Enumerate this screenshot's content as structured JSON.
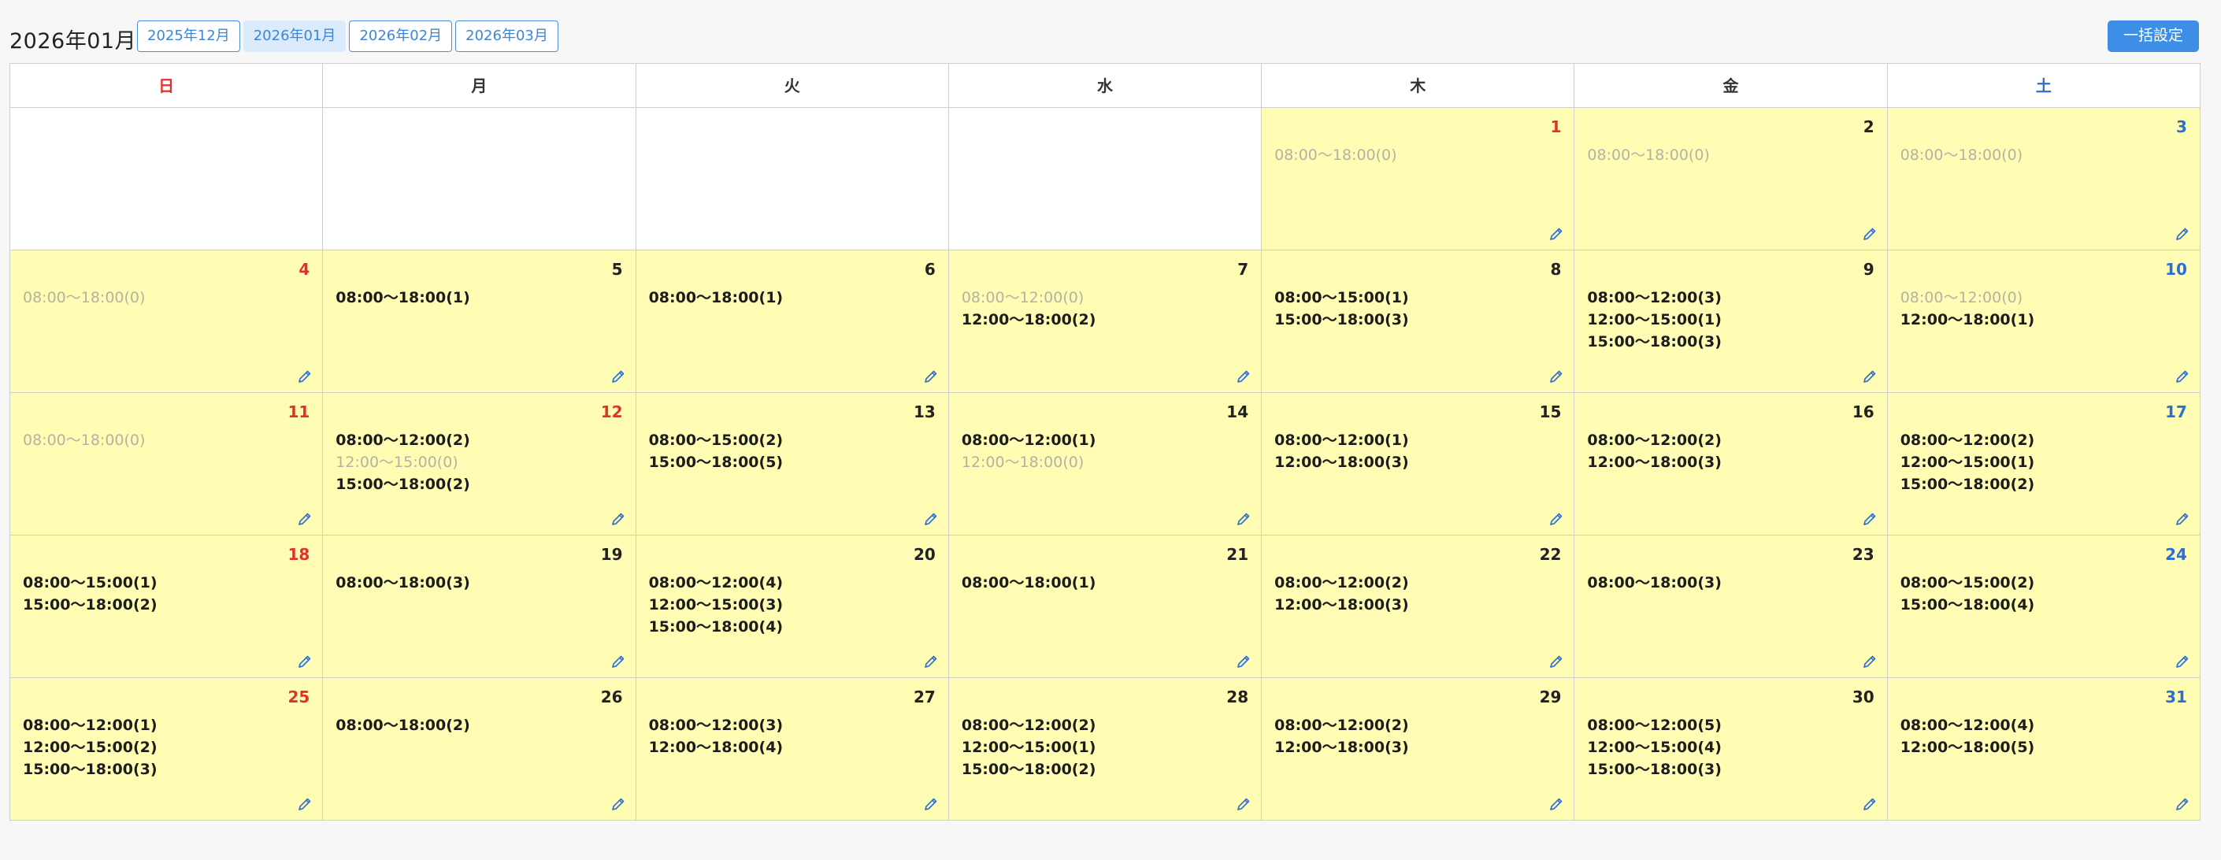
{
  "header": {
    "title": "2026年01月",
    "month_tabs": [
      {
        "label": "2025年12月",
        "active": false
      },
      {
        "label": "2026年01月",
        "active": true
      },
      {
        "label": "2026年02月",
        "active": false
      },
      {
        "label": "2026年03月",
        "active": false
      }
    ],
    "bulk_button_label": "一括設定"
  },
  "colors": {
    "cell_background": "#fffcb4",
    "sunday_holiday": "#e0312f",
    "saturday": "#2b6ed6",
    "accent": "#3c8ee6",
    "zero_slot_text": "#b3b3a4"
  },
  "weekdays": [
    "日",
    "月",
    "火",
    "水",
    "木",
    "金",
    "土"
  ],
  "weeks": [
    [
      null,
      null,
      null,
      null,
      {
        "day": "1",
        "holiday": true,
        "slots": [
          {
            "text": "08:00〜18:00(0)",
            "zero": true
          }
        ]
      },
      {
        "day": "2",
        "slots": [
          {
            "text": "08:00〜18:00(0)",
            "zero": true
          }
        ]
      },
      {
        "day": "3",
        "slots": [
          {
            "text": "08:00〜18:00(0)",
            "zero": true
          }
        ]
      }
    ],
    [
      {
        "day": "4",
        "slots": [
          {
            "text": "08:00〜18:00(0)",
            "zero": true
          }
        ]
      },
      {
        "day": "5",
        "slots": [
          {
            "text": "08:00〜18:00(1)"
          }
        ]
      },
      {
        "day": "6",
        "slots": [
          {
            "text": "08:00〜18:00(1)"
          }
        ]
      },
      {
        "day": "7",
        "slots": [
          {
            "text": "08:00〜12:00(0)",
            "zero": true
          },
          {
            "text": "12:00〜18:00(2)"
          }
        ]
      },
      {
        "day": "8",
        "slots": [
          {
            "text": "08:00〜15:00(1)"
          },
          {
            "text": "15:00〜18:00(3)"
          }
        ]
      },
      {
        "day": "9",
        "slots": [
          {
            "text": "08:00〜12:00(3)"
          },
          {
            "text": "12:00〜15:00(1)"
          },
          {
            "text": "15:00〜18:00(3)"
          }
        ]
      },
      {
        "day": "10",
        "slots": [
          {
            "text": "08:00〜12:00(0)",
            "zero": true
          },
          {
            "text": "12:00〜18:00(1)"
          }
        ]
      }
    ],
    [
      {
        "day": "11",
        "slots": [
          {
            "text": "08:00〜18:00(0)",
            "zero": true
          }
        ]
      },
      {
        "day": "12",
        "holiday": true,
        "slots": [
          {
            "text": "08:00〜12:00(2)"
          },
          {
            "text": "12:00〜15:00(0)",
            "zero": true
          },
          {
            "text": "15:00〜18:00(2)"
          }
        ]
      },
      {
        "day": "13",
        "slots": [
          {
            "text": "08:00〜15:00(2)"
          },
          {
            "text": "15:00〜18:00(5)"
          }
        ]
      },
      {
        "day": "14",
        "slots": [
          {
            "text": "08:00〜12:00(1)"
          },
          {
            "text": "12:00〜18:00(0)",
            "zero": true
          }
        ]
      },
      {
        "day": "15",
        "slots": [
          {
            "text": "08:00〜12:00(1)"
          },
          {
            "text": "12:00〜18:00(3)"
          }
        ]
      },
      {
        "day": "16",
        "slots": [
          {
            "text": "08:00〜12:00(2)"
          },
          {
            "text": "12:00〜18:00(3)"
          }
        ]
      },
      {
        "day": "17",
        "slots": [
          {
            "text": "08:00〜12:00(2)"
          },
          {
            "text": "12:00〜15:00(1)"
          },
          {
            "text": "15:00〜18:00(2)"
          }
        ]
      }
    ],
    [
      {
        "day": "18",
        "slots": [
          {
            "text": "08:00〜15:00(1)"
          },
          {
            "text": "15:00〜18:00(2)"
          }
        ]
      },
      {
        "day": "19",
        "slots": [
          {
            "text": "08:00〜18:00(3)"
          }
        ]
      },
      {
        "day": "20",
        "slots": [
          {
            "text": "08:00〜12:00(4)"
          },
          {
            "text": "12:00〜15:00(3)"
          },
          {
            "text": "15:00〜18:00(4)"
          }
        ]
      },
      {
        "day": "21",
        "slots": [
          {
            "text": "08:00〜18:00(1)"
          }
        ]
      },
      {
        "day": "22",
        "slots": [
          {
            "text": "08:00〜12:00(2)"
          },
          {
            "text": "12:00〜18:00(3)"
          }
        ]
      },
      {
        "day": "23",
        "slots": [
          {
            "text": "08:00〜18:00(3)"
          }
        ]
      },
      {
        "day": "24",
        "slots": [
          {
            "text": "08:00〜15:00(2)"
          },
          {
            "text": "15:00〜18:00(4)"
          }
        ]
      }
    ],
    [
      {
        "day": "25",
        "slots": [
          {
            "text": "08:00〜12:00(1)"
          },
          {
            "text": "12:00〜15:00(2)"
          },
          {
            "text": "15:00〜18:00(3)"
          }
        ]
      },
      {
        "day": "26",
        "slots": [
          {
            "text": "08:00〜18:00(2)"
          }
        ]
      },
      {
        "day": "27",
        "slots": [
          {
            "text": "08:00〜12:00(3)"
          },
          {
            "text": "12:00〜18:00(4)"
          }
        ]
      },
      {
        "day": "28",
        "slots": [
          {
            "text": "08:00〜12:00(2)"
          },
          {
            "text": "12:00〜15:00(1)"
          },
          {
            "text": "15:00〜18:00(2)"
          }
        ]
      },
      {
        "day": "29",
        "slots": [
          {
            "text": "08:00〜12:00(2)"
          },
          {
            "text": "12:00〜18:00(3)"
          }
        ]
      },
      {
        "day": "30",
        "slots": [
          {
            "text": "08:00〜12:00(5)"
          },
          {
            "text": "12:00〜15:00(4)"
          },
          {
            "text": "15:00〜18:00(3)"
          }
        ]
      },
      {
        "day": "31",
        "slots": [
          {
            "text": "08:00〜12:00(4)"
          },
          {
            "text": "12:00〜18:00(5)"
          }
        ]
      }
    ]
  ]
}
